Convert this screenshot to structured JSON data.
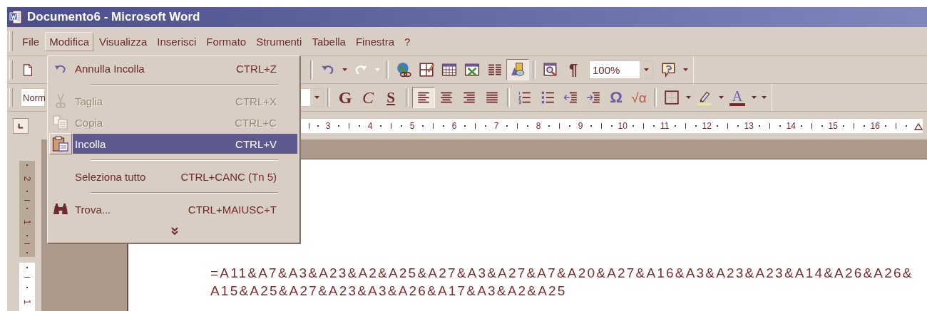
{
  "window": {
    "title": "Documento6 - Microsoft Word"
  },
  "menu_bar": [
    {
      "label": "File",
      "selected": false
    },
    {
      "label": "Modifica",
      "selected": true
    },
    {
      "label": "Visualizza",
      "selected": false
    },
    {
      "label": "Inserisci",
      "selected": false
    },
    {
      "label": "Formato",
      "selected": false
    },
    {
      "label": "Strumenti",
      "selected": false
    },
    {
      "label": "Tabella",
      "selected": false
    },
    {
      "label": "Finestra",
      "selected": false
    },
    {
      "label": "?",
      "selected": false
    }
  ],
  "edit_menu": {
    "items": [
      {
        "kind": "undo",
        "label": "Annulla Incolla",
        "shortcut": "CTRL+Z",
        "disabled": false,
        "selected": false
      },
      {
        "kind": "separator"
      },
      {
        "kind": "cut",
        "label": "Taglia",
        "shortcut": "CTRL+X",
        "disabled": true,
        "selected": false
      },
      {
        "kind": "copy",
        "label": "Copia",
        "shortcut": "CTRL+C",
        "disabled": true,
        "selected": false
      },
      {
        "kind": "paste",
        "label": "Incolla",
        "shortcut": "CTRL+V",
        "disabled": false,
        "selected": true
      },
      {
        "kind": "separator"
      },
      {
        "kind": "plain",
        "label": "Seleziona tutto",
        "shortcut": "CTRL+CANC (Tn 5)",
        "disabled": false,
        "selected": false
      },
      {
        "kind": "separator"
      },
      {
        "kind": "find",
        "label": "Trova...",
        "shortcut": "CTRL+MAIUSC+T",
        "disabled": false,
        "selected": false
      },
      {
        "kind": "expand"
      }
    ]
  },
  "standard_toolbar": {
    "left_items": [
      {
        "kind": "new",
        "pressed": false,
        "disabled": false
      }
    ],
    "right_items": [
      {
        "kind": "separator"
      },
      {
        "kind": "undo",
        "pressed": false,
        "disabled": false
      },
      {
        "kind": "arrow",
        "pressed": false,
        "disabled": false
      },
      {
        "kind": "redo",
        "pressed": false,
        "disabled": true
      },
      {
        "kind": "arrow",
        "pressed": false,
        "disabled": true
      },
      {
        "kind": "separator"
      },
      {
        "kind": "hyperlink",
        "pressed": false,
        "disabled": false
      },
      {
        "kind": "tables_borders",
        "pressed": false,
        "disabled": false
      },
      {
        "kind": "insert_table",
        "pressed": false,
        "disabled": false
      },
      {
        "kind": "insert_sheet",
        "pressed": false,
        "disabled": false
      },
      {
        "kind": "columns",
        "pressed": false,
        "disabled": false
      },
      {
        "kind": "drawing",
        "pressed": true,
        "disabled": false
      },
      {
        "kind": "separator"
      },
      {
        "kind": "doc_map",
        "pressed": false,
        "disabled": false
      },
      {
        "kind": "pilcrow",
        "label": "¶",
        "pressed": false,
        "disabled": false
      },
      {
        "kind": "zoom",
        "value": "100%"
      },
      {
        "kind": "help",
        "pressed": false,
        "disabled": false
      },
      {
        "kind": "arrow",
        "pressed": false,
        "disabled": false
      }
    ]
  },
  "formatting_toolbar": {
    "left_items": [
      {
        "kind": "style",
        "value": "Norm"
      }
    ],
    "right_items": [
      {
        "kind": "size"
      },
      {
        "kind": "separator"
      },
      {
        "kind": "bold",
        "label": "G",
        "pressed": false,
        "disabled": false
      },
      {
        "kind": "italic",
        "label": "C",
        "pressed": false,
        "disabled": false
      },
      {
        "kind": "underline",
        "label": "S",
        "pressed": false,
        "disabled": false
      },
      {
        "kind": "separator"
      },
      {
        "kind": "align_left",
        "pressed": true,
        "disabled": false
      },
      {
        "kind": "align_center",
        "pressed": false,
        "disabled": false
      },
      {
        "kind": "align_right",
        "pressed": false,
        "disabled": false
      },
      {
        "kind": "justify",
        "pressed": false,
        "disabled": false
      },
      {
        "kind": "separator"
      },
      {
        "kind": "numbering",
        "pressed": false,
        "disabled": false
      },
      {
        "kind": "bullets",
        "pressed": false,
        "disabled": false
      },
      {
        "kind": "outdent",
        "pressed": false,
        "disabled": false
      },
      {
        "kind": "indent",
        "pressed": false,
        "disabled": false
      },
      {
        "kind": "symbol",
        "label": "Ω",
        "pressed": false,
        "disabled": false
      },
      {
        "kind": "equation",
        "label": "√α",
        "pressed": false,
        "disabled": false
      },
      {
        "kind": "separator"
      },
      {
        "kind": "border",
        "pressed": false,
        "disabled": false
      },
      {
        "kind": "arrow",
        "pressed": false,
        "disabled": false
      },
      {
        "kind": "highlight",
        "pressed": false,
        "disabled": false
      },
      {
        "kind": "arrow",
        "pressed": false,
        "disabled": false
      },
      {
        "kind": "font_color",
        "label": "A",
        "pressed": false,
        "disabled": false
      },
      {
        "kind": "arrow",
        "pressed": false,
        "disabled": false
      },
      {
        "kind": "arrow",
        "pressed": false,
        "disabled": false
      }
    ]
  },
  "ruler": {
    "labels": [
      "3",
      "4",
      "5",
      "6",
      "7",
      "8",
      "9",
      "10",
      "11",
      "12",
      "13",
      "14",
      "15",
      "16"
    ]
  },
  "vertical_ruler": {
    "labels": [
      "2",
      "1",
      "1"
    ]
  },
  "document": {
    "lines": [
      "=A11&A7&A3&A23&A2&A25&A27&A3&A27&A7&A20&A27&A16&A3&A23&A23&A14&A26&A26&",
      "A15&A25&A27&A23&A3&A26&A17&A3&A2&A25"
    ]
  }
}
